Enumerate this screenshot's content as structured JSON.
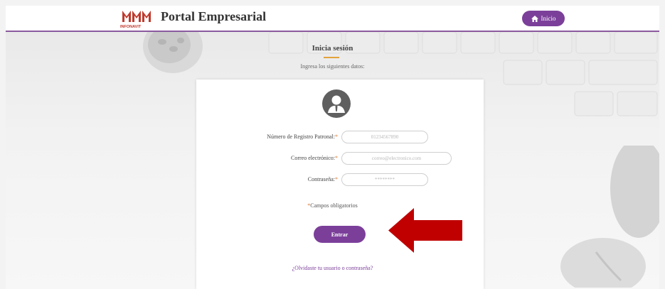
{
  "header": {
    "logo_text": "INFONAVIT",
    "title": "Portal Empresarial",
    "home_label": "Inicio",
    "home_icon": "home-icon"
  },
  "intro": {
    "title": "Inicia sesión",
    "subtitle": "Ingresa los siguientes datos:"
  },
  "form": {
    "avatar_icon": "user-avatar-icon",
    "fields": [
      {
        "label": "Número de Registro Patronal:",
        "required_mark": "*",
        "placeholder": "01234567890"
      },
      {
        "label": "Correo electrónico:",
        "required_mark": "*",
        "placeholder": "correo@electronico.com"
      },
      {
        "label": "Contraseña:",
        "required_mark": "*",
        "placeholder": "********"
      }
    ],
    "required_note_mark": "*",
    "required_note": "Campos obligatorios",
    "submit_label": "Entrar",
    "forgot_link": "¿Olvidaste tu usuario o contraseña?"
  },
  "annotation": {
    "arrow_icon": "red-arrow-icon",
    "color": "#c00000"
  },
  "colors": {
    "accent": "#7b3f9a",
    "required": "#e07a2e",
    "underline": "#e3a33b"
  }
}
